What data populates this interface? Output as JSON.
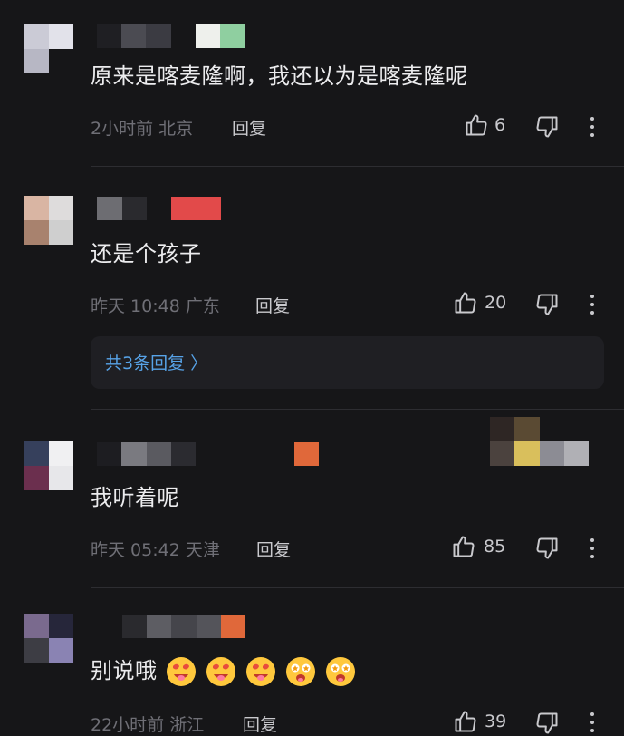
{
  "comments": [
    {
      "text": "原来是喀麦隆啊，我还以为是喀麦隆呢",
      "meta": "2小时前 北京",
      "reply": "回复",
      "likes": "6"
    },
    {
      "text": "还是个孩子",
      "meta": "昨天 10:48 广东",
      "reply": "回复",
      "likes": "20",
      "replies_label": "共3条回复 〉"
    },
    {
      "text": "我听着呢",
      "meta": "昨天 05:42 天津",
      "reply": "回复",
      "likes": "85"
    },
    {
      "text": "别说哦",
      "emojis": [
        "heart-eyes-tongue-emoji",
        "heart-eyes-tongue-emoji",
        "heart-eyes-tongue-emoji",
        "starry-eyes-emoji",
        "starry-eyes-emoji"
      ],
      "meta": "22小时前 浙江",
      "reply": "回复",
      "likes": "39"
    }
  ],
  "colors": {
    "background": "#161618",
    "text": "#ececee",
    "meta": "#6f6f76",
    "link": "#57a3e8",
    "badge_red": "#e24a4a",
    "badge_orange": "#e0683a",
    "badge_green": "#8fcfa0"
  },
  "icons": [
    "thumbs-up-icon",
    "thumbs-down-icon",
    "more-vertical-icon",
    "chevron-right-icon"
  ]
}
